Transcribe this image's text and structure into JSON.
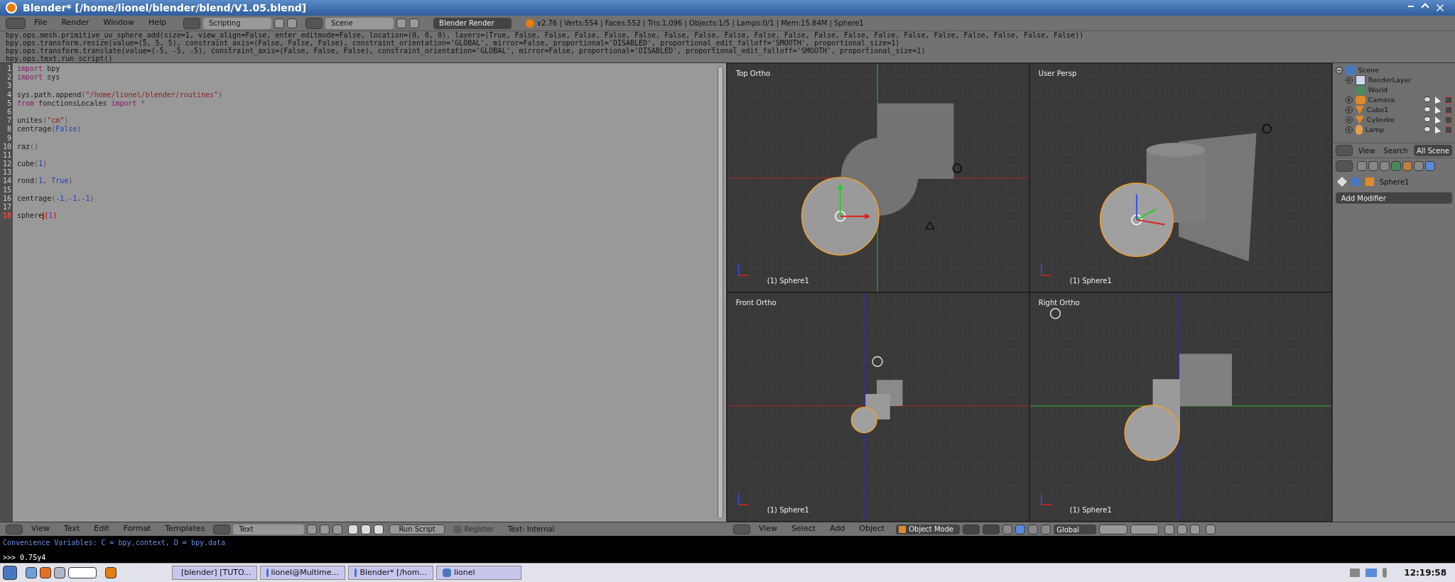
{
  "window": {
    "title": "Blender* [/home/lionel/blender/blend/V1.05.blend]"
  },
  "top_header": {
    "menus": [
      "File",
      "Render",
      "Window",
      "Help"
    ],
    "screen": "Scripting",
    "scene": "Scene",
    "render_engine": "Blender Render",
    "stats": "v2.76 | Verts:554 | Faces:552 | Tris:1,096 | Objects:1/5 | Lamps:0/1 | Mem:15.84M | Sphere1"
  },
  "info_log": [
    "bpy.ops.mesh.primitive_uv_sphere_add(size=1, view_align=False, enter_editmode=False, location=(0, 0, 0), layers=(True, False, False, False, False, False, False, False, False, False, False, False, False, False, False, False, False, False, False, False))",
    "bpy.ops.transform.resize(value=(5, 5, 5), constraint_axis=(False, False, False), constraint_orientation='GLOBAL', mirror=False, proportional='DISABLED', proportional_edit_falloff='SMOOTH', proportional_size=1)",
    "bpy.ops.transform.translate(value=(-5, -5, -5), constraint_axis=(False, False, False), constraint_orientation='GLOBAL', mirror=False, proportional='DISABLED', proportional_edit_falloff='SMOOTH', proportional_size=1)",
    "bpy.ops.text.run_script()"
  ],
  "text_editor": {
    "lines": [
      {
        "number": "1",
        "current": false,
        "segments": [
          {
            "kind": "keyword",
            "text": "import"
          },
          {
            "kind": "plain",
            "text": " bpy"
          }
        ]
      },
      {
        "number": "2",
        "current": false,
        "segments": [
          {
            "kind": "keyword",
            "text": "import"
          },
          {
            "kind": "plain",
            "text": " sys"
          }
        ]
      },
      {
        "number": "3",
        "current": false
      },
      {
        "number": "4",
        "current": false,
        "segments": [
          {
            "kind": "plain",
            "text": "sys.path.append"
          },
          {
            "kind": "punct",
            "text": "("
          },
          {
            "kind": "string",
            "text": "\"/home/lionel/blender/routines\""
          },
          {
            "kind": "punct",
            "text": ")"
          }
        ]
      },
      {
        "number": "5",
        "current": false,
        "segments": [
          {
            "kind": "keyword",
            "text": "from"
          },
          {
            "kind": "plain",
            "text": " fonctionsLocales "
          },
          {
            "kind": "keyword",
            "text": "import"
          },
          {
            "kind": "punct",
            "text": " *"
          }
        ]
      },
      {
        "number": "6",
        "current": false
      },
      {
        "number": "7",
        "current": false,
        "segments": [
          {
            "kind": "plain",
            "text": "unites"
          },
          {
            "kind": "punct",
            "text": "("
          },
          {
            "kind": "string",
            "text": "\"cm\""
          },
          {
            "kind": "punct",
            "text": ")"
          }
        ]
      },
      {
        "number": "8",
        "current": false,
        "segments": [
          {
            "kind": "plain",
            "text": "centrage"
          },
          {
            "kind": "punct",
            "text": "("
          },
          {
            "kind": "number",
            "text": "False"
          },
          {
            "kind": "punct",
            "text": ")"
          }
        ]
      },
      {
        "number": "9",
        "current": false
      },
      {
        "number": "10",
        "current": false,
        "segments": [
          {
            "kind": "plain",
            "text": "raz"
          },
          {
            "kind": "punct",
            "text": "()"
          }
        ]
      },
      {
        "number": "11",
        "current": false
      },
      {
        "number": "12",
        "current": false,
        "segments": [
          {
            "kind": "plain",
            "text": "cube"
          },
          {
            "kind": "punct",
            "text": "("
          },
          {
            "kind": "number",
            "text": "1"
          },
          {
            "kind": "punct",
            "text": ")"
          }
        ]
      },
      {
        "number": "13",
        "current": false
      },
      {
        "number": "14",
        "current": false,
        "segments": [
          {
            "kind": "plain",
            "text": "rond"
          },
          {
            "kind": "punct",
            "text": "("
          },
          {
            "kind": "number",
            "text": "1"
          },
          {
            "kind": "punct",
            "text": ", "
          },
          {
            "kind": "number",
            "text": "True"
          },
          {
            "kind": "punct",
            "text": ")"
          }
        ]
      },
      {
        "number": "15",
        "current": false
      },
      {
        "number": "16",
        "current": false,
        "segments": [
          {
            "kind": "plain",
            "text": "centrage"
          },
          {
            "kind": "punct",
            "text": "("
          },
          {
            "kind": "number",
            "text": "-1"
          },
          {
            "kind": "punct",
            "text": ","
          },
          {
            "kind": "number",
            "text": "-1"
          },
          {
            "kind": "punct",
            "text": ","
          },
          {
            "kind": "number",
            "text": "-1"
          },
          {
            "kind": "punct",
            "text": ")"
          }
        ]
      },
      {
        "number": "17",
        "current": false
      },
      {
        "number": "18",
        "current": true,
        "segments": [
          {
            "kind": "plain",
            "text": "sphere"
          },
          {
            "kind": "cursor"
          },
          {
            "kind": "bracket",
            "text": "("
          },
          {
            "kind": "number",
            "text": "1"
          },
          {
            "kind": "bracket",
            "text": ")"
          }
        ]
      }
    ],
    "footer": {
      "menus": [
        "View",
        "Text",
        "Edit",
        "Format",
        "Templates"
      ],
      "text_name": "Text",
      "run_button": "Run Script",
      "register": {
        "label": "Register",
        "checked": false,
        "disabled": true
      },
      "status": "Text: Internal"
    }
  },
  "viewports": [
    {
      "kind": "top",
      "label": "Top Ortho",
      "object_label": "(1) Sphere1"
    },
    {
      "kind": "persp",
      "label": "User Persp",
      "object_label": "(1) Sphere1"
    },
    {
      "kind": "front",
      "label": "Front Ortho",
      "object_label": "(1) Sphere1"
    },
    {
      "kind": "right",
      "label": "Right Ortho",
      "object_label": "(1) Sphere1"
    }
  ],
  "viewport_header": {
    "menus": [
      "View",
      "Select",
      "Add",
      "Object"
    ],
    "mode": "Object Mode",
    "orientation": "Global"
  },
  "outliner": {
    "tree": [
      {
        "kind": "scene",
        "name": "Scene",
        "expanded": true,
        "children": [
          {
            "kind": "layer",
            "name": "RenderLayer",
            "expanded": false
          },
          {
            "kind": "world",
            "name": "World"
          },
          {
            "kind": "camera",
            "name": "Camera",
            "expanded": false
          },
          {
            "kind": "mesh",
            "name": "Cube1",
            "expanded": false
          },
          {
            "kind": "mesh",
            "name": "Cylindre",
            "expanded": false
          },
          {
            "kind": "lamp",
            "name": "Lamp",
            "expanded": false
          }
        ]
      }
    ],
    "header": {
      "menus": [
        "View",
        "Search"
      ],
      "filter": "All Scene"
    }
  },
  "properties": {
    "object": "Sphere1",
    "add_modifier": "Add Modifier"
  },
  "console": {
    "lines": [
      "Convenience Variables: C = bpy.context, D = bpy.data"
    ],
    "input": ">>> 0.75y4"
  },
  "taskbar": {
    "items": [
      "[blender] [TUTO...",
      "lionel@Multime...",
      "Blender* [/hom...",
      "lionel"
    ],
    "clock": "12:19:58"
  }
}
